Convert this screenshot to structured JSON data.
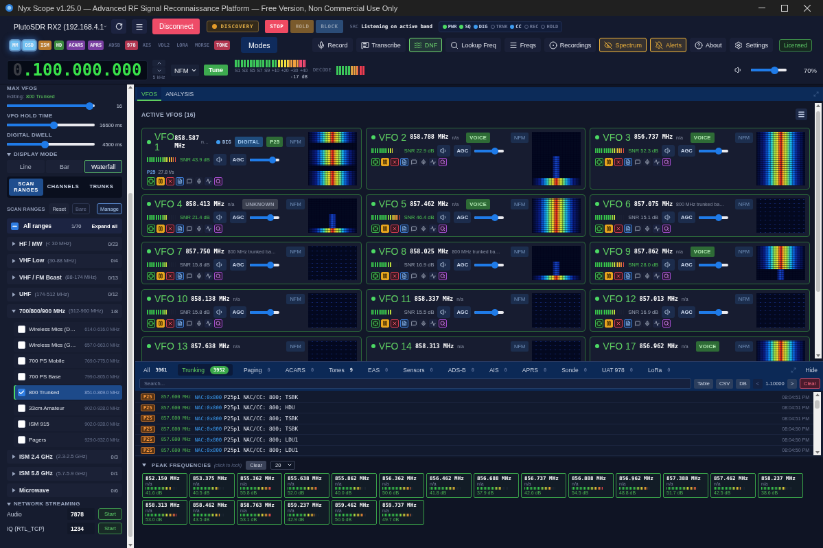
{
  "window": {
    "title": "Nyx Scope v1.25.0 — Advanced RF Signal Reconnaissance Platform — Free Version, Non Commercial Use Only"
  },
  "toolbar": {
    "device": "PlutoSDR RX2 (192.168.4.1",
    "connect_button": "Disconnect",
    "discovery": "DISCOVERY",
    "controls": [
      {
        "label": "STOP",
        "active": true,
        "color": "#ef4a62"
      },
      {
        "label": "HOLD",
        "active": false,
        "color": "#7a5a2c"
      },
      {
        "label": "BLOCK",
        "active": false,
        "color": "#2b4c77"
      }
    ],
    "source_label": "SRC",
    "source_status": "Listening on active band",
    "indicators": [
      {
        "label": "PWR",
        "on": true,
        "color": "#4cd964"
      },
      {
        "label": "SQ",
        "on": true,
        "color": "#4cd964"
      },
      {
        "label": "DIG",
        "on": true,
        "color": "#3d9bf0"
      },
      {
        "label": "TRNK",
        "on": false
      },
      {
        "label": "CC",
        "on": true,
        "color": "#3d9bf0"
      },
      {
        "label": "REC",
        "on": false
      },
      {
        "label": "HOLD",
        "on": false
      }
    ]
  },
  "modes": {
    "chips": [
      {
        "label": "MM",
        "on": true,
        "selected": true,
        "color": "#74c2f2"
      },
      {
        "label": "DSD",
        "on": true,
        "selected": true,
        "color": "#74c2f2"
      },
      {
        "label": "ISM",
        "on": true,
        "selected": false,
        "color": "#b87a2c"
      },
      {
        "label": "HD",
        "on": true,
        "selected": false,
        "color": "#3b8a3e"
      },
      {
        "label": "ACARS",
        "on": true,
        "selected": false,
        "color": "#7a3fa2"
      },
      {
        "label": "APRS",
        "on": true,
        "selected": false,
        "color": "#7a3fa2"
      },
      {
        "label": "ADSB",
        "on": false,
        "selected": false
      },
      {
        "label": "978",
        "on": true,
        "selected": false,
        "color": "#b23650"
      },
      {
        "label": "AIS",
        "on": false,
        "selected": false
      },
      {
        "label": "VDL2",
        "on": false,
        "selected": false
      },
      {
        "label": "LORA",
        "on": false,
        "selected": false
      },
      {
        "label": "MORSE",
        "on": false,
        "selected": false
      },
      {
        "label": "TONE",
        "on": true,
        "selected": false,
        "color": "#b23650"
      }
    ],
    "button": "Modes"
  },
  "actions": [
    {
      "label": "Record",
      "kind": "record",
      "active": false
    },
    {
      "label": "Transcribe",
      "kind": "transcribe",
      "active": false
    },
    {
      "label": "DNF",
      "kind": "dnf",
      "active": true,
      "color": "#6fd86f"
    },
    {
      "label": "Lookup Freq",
      "kind": "lookup",
      "active": false
    },
    {
      "label": "Freqs",
      "kind": "freqs",
      "active": false
    },
    {
      "label": "Recordings",
      "kind": "recordings",
      "active": false
    },
    {
      "label": "Spectrum",
      "kind": "spectrum",
      "active": true,
      "color": "#f0b43c"
    },
    {
      "label": "Alerts",
      "kind": "alerts",
      "active": true,
      "color": "#f0b43c"
    },
    {
      "label": "About",
      "kind": "about",
      "active": false
    },
    {
      "label": "Settings",
      "kind": "settings",
      "active": false
    }
  ],
  "license": "Licensed",
  "tuner": {
    "frequency": {
      "dim": "0",
      "value": ".100.000.000"
    },
    "step": "5 kHz",
    "mode": "NFM",
    "tune_button": "Tune",
    "s_meter": {
      "level": 1,
      "ticks": [
        "S1",
        "S3",
        "S5",
        "S7",
        "S9",
        "+10",
        "+20",
        "+30",
        "+40"
      ],
      "reading": "-17 dB"
    },
    "decode": {
      "label": "DECODE",
      "level": 1
    },
    "volume": {
      "level": 0.7,
      "reading": "70%"
    }
  },
  "sidebar": {
    "max_vfos": {
      "label": "MAX VFOS",
      "editing_label": "Editing:",
      "editing_value": "800 Trunked",
      "level": 0.98,
      "reading": "16"
    },
    "sliders": [
      {
        "label": "VFO HOLD TIME",
        "level": 0.54,
        "reading": "16600 ms"
      },
      {
        "label": "DIGITAL DWELL",
        "level": 0.43,
        "reading": "4500 ms"
      }
    ],
    "display_mode": {
      "title": "DISPLAY MODE",
      "expanded": true,
      "options": [
        {
          "label": "Line",
          "selected": false
        },
        {
          "label": "Bar",
          "selected": false
        },
        {
          "label": "Waterfall",
          "selected": true
        }
      ]
    },
    "tabs": [
      {
        "label": "SCAN RANGES",
        "selected": true
      },
      {
        "label": "CHANNELS",
        "selected": false
      },
      {
        "label": "TRUNKS",
        "selected": false
      }
    ],
    "scan_ranges": {
      "title": "SCAN RANGES",
      "buttons": [
        {
          "label": "Reset",
          "kind": "plain",
          "disabled": false
        },
        {
          "label": "Bare",
          "kind": "plain",
          "disabled": true
        },
        {
          "label": "Manage",
          "kind": "outline",
          "disabled": false
        }
      ],
      "all": {
        "label": "All ranges",
        "indeterminate": true,
        "count": "1/70",
        "expand": "Expand all"
      },
      "groups": [
        {
          "name": "HF / MW",
          "range": "(< 30 MHz)",
          "count": "0/23",
          "expanded": false
        },
        {
          "name": "VHF Low",
          "range": "(30-88 MHz)",
          "count": "0/4",
          "expanded": false
        },
        {
          "name": "VHF / FM Bcast",
          "range": "(88-174 MHz)",
          "count": "0/13",
          "expanded": false
        },
        {
          "name": "UHF",
          "range": "(174-512 MHz)",
          "count": "0/12",
          "expanded": false
        },
        {
          "name": "700/800/900 MHz",
          "range": "(512-960 MHz)",
          "count": "1/8",
          "expanded": true,
          "children": [
            {
              "name": "Wireless Mics (D…",
              "range": "614.0-616.0 MHz",
              "checked": false,
              "selected": false
            },
            {
              "name": "Wireless Mics (G…",
              "range": "657.0-663.0 MHz",
              "checked": false,
              "selected": false
            },
            {
              "name": "700 PS Mobile",
              "range": "769.0-775.0 MHz",
              "checked": false,
              "selected": false
            },
            {
              "name": "700 PS Base",
              "range": "799.0-805.0 MHz",
              "checked": false,
              "selected": false
            },
            {
              "name": "800 Trunked",
              "range": "851.0-869.0 MHz",
              "checked": true,
              "selected": true
            },
            {
              "name": "33cm Amateur",
              "range": "902.0-928.0 MHz",
              "checked": false,
              "selected": false
            },
            {
              "name": "ISM 915",
              "range": "902.0-928.0 MHz",
              "checked": false,
              "selected": false
            },
            {
              "name": "Pagers",
              "range": "929.0-932.0 MHz",
              "checked": false,
              "selected": false
            }
          ]
        },
        {
          "name": "ISM 2.4 GHz",
          "range": "(2.3-2.5 GHz)",
          "count": "0/3",
          "expanded": false
        },
        {
          "name": "ISM 5.8 GHz",
          "range": "(5.7-5.9 GHz)",
          "count": "0/1",
          "expanded": false
        },
        {
          "name": "Microwave",
          "count": "0/6",
          "expanded": false
        }
      ]
    },
    "streaming": {
      "title": "NETWORK STREAMING",
      "expanded": true,
      "rows": [
        {
          "label": "Audio",
          "port": "7878",
          "button": "Start"
        },
        {
          "label": "IQ (RTL_TCP)",
          "port": "1234",
          "button": "Start"
        }
      ]
    }
  },
  "vfo_panel": {
    "tabs": [
      {
        "label": "VFOS",
        "selected": true
      },
      {
        "label": "ANALYSIS",
        "selected": false
      }
    ],
    "title": "ACTIVE VFOS (16)",
    "vfos": [
      {
        "name": "VFO 1",
        "frequency": "858.587 MHz",
        "info": "n…",
        "digital": "DIG",
        "badges": [
          {
            "label": "DIGITAL",
            "kind": "digital"
          },
          {
            "label": "P25",
            "kind": "protocol"
          }
        ],
        "demod": "NFM",
        "meter": {
          "level": 1
        },
        "snr": "SNR 43.9 dB",
        "snr_ok": true,
        "agc": "AGC",
        "volume": {
          "level": 0.84
        },
        "decoder": {
          "label": "P25",
          "rate": "27.8 f/s"
        },
        "waterfall": {
          "kind": "split"
        }
      },
      {
        "name": "VFO 2",
        "frequency": "858.788 MHz",
        "info": "n/a",
        "badges": [
          {
            "label": "VOICE",
            "kind": "voice"
          }
        ],
        "demod": "NFM",
        "meter": {
          "level": 0.72
        },
        "snr": "SNR 22.9 dB",
        "snr_ok": true,
        "agc": "AGC",
        "volume": {
          "level": 0.74
        },
        "waterfall": {
          "kind": "bottom"
        }
      },
      {
        "name": "VFO 3",
        "frequency": "856.737 MHz",
        "info": "n/a",
        "badges": [
          {
            "label": "VOICE",
            "kind": "voice"
          }
        ],
        "demod": "NFM",
        "meter": {
          "level": 1
        },
        "snr": "SNR 52.3 dB",
        "snr_ok": true,
        "agc": "AGC",
        "volume": {
          "level": 0.74
        },
        "waterfall": {
          "kind": "full"
        }
      },
      {
        "name": "VFO 4",
        "frequency": "858.413 MHz",
        "info": "n/a",
        "badges": [
          {
            "label": "UNKNOWN",
            "kind": "unknown"
          }
        ],
        "demod": "NFM",
        "meter": {
          "level": 0.7
        },
        "snr": "SNR 21.4 dB",
        "snr_ok": true,
        "agc": "AGC",
        "volume": {
          "level": 0.74
        },
        "waterfall": {
          "kind": "bottom"
        }
      },
      {
        "name": "VFO 5",
        "frequency": "857.462 MHz",
        "info": "n/a",
        "badges": [
          {
            "label": "VOICE",
            "kind": "voice"
          }
        ],
        "demod": "NFM",
        "meter": {
          "level": 1
        },
        "snr": "SNR 46.4 dB",
        "snr_ok": true,
        "agc": "AGC",
        "volume": {
          "level": 0.74
        },
        "waterfall": {
          "kind": "full"
        }
      },
      {
        "name": "VFO 6",
        "frequency": "857.075 MHz",
        "info": "800 MHz trunked ba…",
        "demod": "NFM",
        "meter": {
          "level": 0.68
        },
        "snr": "SNR 15.1 dB",
        "snr_ok": false,
        "agc": "AGC",
        "volume": {
          "level": 0.74
        },
        "waterfall": {
          "kind": "empty"
        }
      },
      {
        "name": "VFO 7",
        "frequency": "857.750 MHz",
        "info": "800 MHz trunked ba…",
        "demod": "NFM",
        "meter": {
          "level": 0.68
        },
        "snr": "SNR 15.8 dB",
        "snr_ok": false,
        "agc": "AGC",
        "volume": {
          "level": 0.74
        },
        "waterfall": {
          "kind": "empty"
        }
      },
      {
        "name": "VFO 8",
        "frequency": "858.025 MHz",
        "info": "800 MHz trunked ba…",
        "demod": "NFM",
        "meter": {
          "level": 0.68
        },
        "snr": "SNR 16.9 dB",
        "snr_ok": false,
        "agc": "AGC",
        "volume": {
          "level": 0.74
        },
        "waterfall": {
          "kind": "bottom"
        }
      },
      {
        "name": "VFO 9",
        "frequency": "857.862 MHz",
        "info": "n/a",
        "badges": [
          {
            "label": "VOICE",
            "kind": "voice"
          }
        ],
        "demod": "NFM",
        "meter": {
          "level": 1
        },
        "snr": "SNR 28.0 dB",
        "snr_ok": true,
        "agc": "AGC",
        "volume": {
          "level": 0.74
        },
        "waterfall": {
          "kind": "top"
        }
      },
      {
        "name": "VFO 10",
        "frequency": "858.138 MHz",
        "info": "n/a",
        "demod": "NFM",
        "meter": {
          "level": 0.68
        },
        "snr": "SNR 15.8 dB",
        "snr_ok": false,
        "agc": "AGC",
        "volume": {
          "level": 0.74
        },
        "waterfall": {
          "kind": "empty"
        }
      },
      {
        "name": "VFO 11",
        "frequency": "858.337 MHz",
        "info": "n/a",
        "demod": "NFM",
        "meter": {
          "level": 0.68
        },
        "snr": "SNR 15.5 dB",
        "snr_ok": false,
        "agc": "AGC",
        "volume": {
          "level": 0.74
        },
        "waterfall": {
          "kind": "empty"
        }
      },
      {
        "name": "VFO 12",
        "frequency": "857.013 MHz",
        "info": "n/a",
        "demod": "NFM",
        "meter": {
          "level": 0.68
        },
        "snr": "SNR 16.9 dB",
        "snr_ok": false,
        "agc": "AGC",
        "volume": {
          "level": 0.74
        },
        "waterfall": {
          "kind": "empty"
        }
      },
      {
        "name": "VFO 13",
        "frequency": "857.638 MHz",
        "info": "n/a",
        "demod": "NFM",
        "waterfall": {
          "kind": "empty"
        }
      },
      {
        "name": "VFO 14",
        "frequency": "858.313 MHz",
        "info": "n/a",
        "demod": "NFM",
        "waterfall": {
          "kind": "empty"
        }
      },
      {
        "name": "VFO 17",
        "frequency": "856.962 MHz",
        "info": "n/a",
        "badges": [
          {
            "label": "VOICE",
            "kind": "voice"
          }
        ],
        "demod": "NFM",
        "waterfall": {
          "kind": "full"
        }
      }
    ]
  },
  "feed": {
    "tabs": [
      {
        "label": "All",
        "count": "3961",
        "selected": false,
        "muted": false
      },
      {
        "label": "Trunking",
        "count": "3952",
        "selected": true,
        "muted": false
      },
      {
        "label": "Paging",
        "count": "0",
        "selected": false,
        "muted": true
      },
      {
        "label": "ACARS",
        "count": "0",
        "selected": false,
        "muted": true
      },
      {
        "label": "Tones",
        "count": "9",
        "selected": false,
        "muted": false
      },
      {
        "label": "EAS",
        "count": "0",
        "selected": false,
        "muted": true
      },
      {
        "label": "Sensors",
        "count": "0",
        "selected": false,
        "muted": true
      },
      {
        "label": "ADS-B",
        "count": "0",
        "selected": false,
        "muted": true
      },
      {
        "label": "AIS",
        "count": "0",
        "selected": false,
        "muted": true
      },
      {
        "label": "APRS",
        "count": "0",
        "selected": false,
        "muted": true
      },
      {
        "label": "Sonde",
        "count": "0",
        "selected": false,
        "muted": true
      },
      {
        "label": "UAT 978",
        "count": "0",
        "selected": false,
        "muted": true
      },
      {
        "label": "LoRa",
        "count": "0",
        "selected": false,
        "muted": true
      }
    ],
    "hide": "Hide",
    "search": {
      "placeholder": "Search..."
    },
    "buttons": [
      "Table",
      "CSV",
      "DB"
    ],
    "pager": {
      "prev": "<",
      "prev_disabled": true,
      "range": "1-10000",
      "next": ">"
    },
    "clear": "Clear",
    "rows": [
      {
        "tag": "P25",
        "frequency": "857.600 MHz",
        "nac": "NAC:0x800",
        "message": "P25p1 NAC/CC: 800; TSBK",
        "time": "08:04:51 PM"
      },
      {
        "tag": "P25",
        "frequency": "857.600 MHz",
        "nac": "NAC:0x800",
        "message": "P25p1 NAC/CC: 800; HDU",
        "time": "08:04:51 PM"
      },
      {
        "tag": "P25",
        "frequency": "857.600 MHz",
        "nac": "NAC:0x800",
        "message": "P25p1 NAC/CC: 800; TSBK",
        "time": "08:04:51 PM"
      },
      {
        "tag": "P25",
        "frequency": "857.600 MHz",
        "nac": "NAC:0x800",
        "message": "P25p1 NAC/CC: 800; TSBK",
        "time": "08:04:50 PM"
      },
      {
        "tag": "P25",
        "frequency": "857.600 MHz",
        "nac": "NAC:0x800",
        "message": "P25p1 NAC/CC: 800; LDU1",
        "time": "08:04:50 PM"
      },
      {
        "tag": "P25",
        "frequency": "857.600 MHz",
        "nac": "NAC:0x800",
        "message": "P25p1 NAC/CC: 800; LDU1",
        "time": "08:04:50 PM"
      }
    ]
  },
  "peaks": {
    "title": "PEAK FREQUENCIES",
    "hint": "(click to lock)",
    "expanded": true,
    "clear": "Clear",
    "limit": "20",
    "tiles": [
      {
        "frequency": "852.150 MHz",
        "info": "n/a",
        "level": 0.85,
        "reading": "41.6 dB"
      },
      {
        "frequency": "853.375 MHz",
        "info": "n/a",
        "level": 0.84,
        "reading": "40.5 dB"
      },
      {
        "frequency": "855.362 MHz",
        "info": "n/a",
        "level": 1,
        "reading": "55.8 dB"
      },
      {
        "frequency": "855.638 MHz",
        "info": "n/a",
        "level": 0.95,
        "reading": "52.0 dB"
      },
      {
        "frequency": "855.862 MHz",
        "info": "n/a",
        "level": 0.82,
        "reading": "40.0 dB"
      },
      {
        "frequency": "856.362 MHz",
        "info": "n/a",
        "level": 0.94,
        "reading": "50.6 dB"
      },
      {
        "frequency": "856.462 MHz",
        "info": "n/a",
        "level": 0.85,
        "reading": "41.8 dB"
      },
      {
        "frequency": "856.688 MHz",
        "info": "n/a",
        "level": 0.8,
        "reading": "37.9 dB"
      },
      {
        "frequency": "856.737 MHz",
        "info": "n/a",
        "level": 0.86,
        "reading": "42.6 dB"
      },
      {
        "frequency": "856.888 MHz",
        "info": "n/a",
        "level": 1,
        "reading": "54.5 dB"
      },
      {
        "frequency": "856.962 MHz",
        "info": "n/a",
        "level": 0.92,
        "reading": "48.8 dB"
      },
      {
        "frequency": "857.388 MHz",
        "info": "n/a",
        "level": 0.95,
        "reading": "51.7 dB"
      },
      {
        "frequency": "857.462 MHz",
        "info": "n/a",
        "level": 0.86,
        "reading": "42.5 dB"
      },
      {
        "frequency": "858.237 MHz",
        "info": "n/a",
        "level": 0.8,
        "reading": "38.6 dB"
      },
      {
        "frequency": "858.313 MHz",
        "info": "n/a",
        "level": 1,
        "reading": "53.0 dB"
      },
      {
        "frequency": "858.462 MHz",
        "info": "n/a",
        "level": 0.87,
        "reading": "43.5 dB"
      },
      {
        "frequency": "858.763 MHz",
        "info": "n/a",
        "level": 1,
        "reading": "53.1 dB"
      },
      {
        "frequency": "859.237 MHz",
        "info": "n/a",
        "level": 0.86,
        "reading": "42.9 dB"
      },
      {
        "frequency": "859.462 MHz",
        "info": "n/a",
        "level": 0.94,
        "reading": "50.6 dB"
      },
      {
        "frequency": "859.737 MHz",
        "info": "n/a",
        "level": 0.93,
        "reading": "49.7 dB"
      }
    ]
  }
}
